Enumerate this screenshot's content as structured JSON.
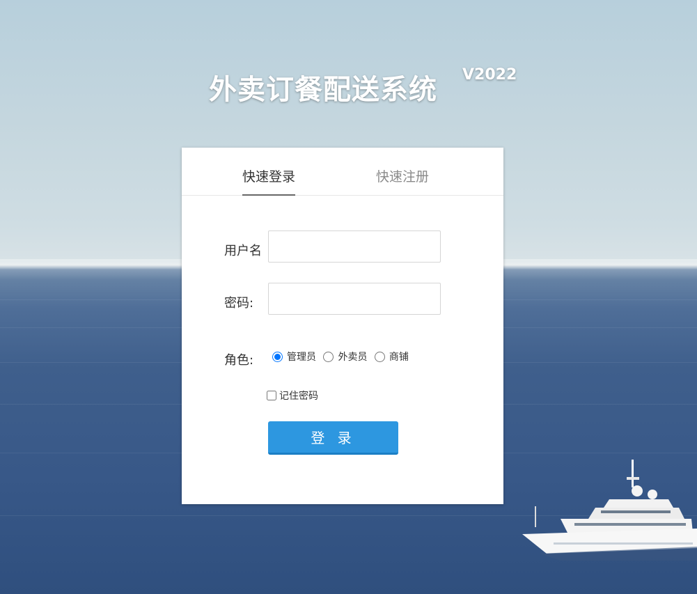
{
  "header": {
    "title": "外卖订餐配送系统",
    "version": "V2022"
  },
  "tabs": [
    {
      "label": "快速登录",
      "active": true
    },
    {
      "label": "快速注册",
      "active": false
    }
  ],
  "form": {
    "username_label": "用户名",
    "username_value": "",
    "password_label": "密码:",
    "password_value": "",
    "role_label": "角色:",
    "roles": [
      {
        "label": "管理员",
        "selected": true
      },
      {
        "label": "外卖员",
        "selected": false
      },
      {
        "label": "商铺",
        "selected": false
      }
    ],
    "remember_label": "记住密码",
    "remember_checked": false,
    "login_button": "登 录"
  },
  "colors": {
    "accent": "#2d97e0",
    "tab_underline": "#666666"
  }
}
